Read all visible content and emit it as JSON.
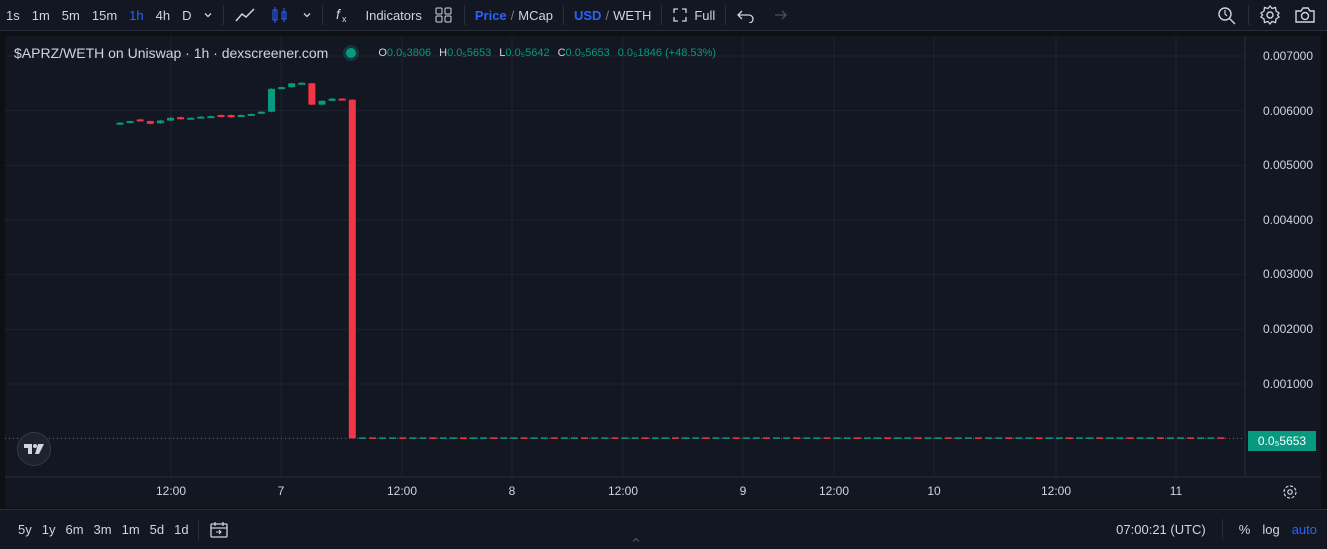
{
  "toolbar": {
    "intervals": [
      "1s",
      "1m",
      "5m",
      "15m",
      "1h",
      "4h",
      "D"
    ],
    "active_interval": "1h",
    "indicators_label": "Indicators",
    "price_label": "Price",
    "mcap_label": "MCap",
    "usd_label": "USD",
    "weth_label": "WETH",
    "full_label": "Full",
    "slash": "/"
  },
  "legend": {
    "symbol": "$APRZ/WETH on Uniswap · 1h · dexscreener.com",
    "o_key": "O",
    "o_val": "0.0₅3806",
    "h_key": "H",
    "h_val": "0.0₅5653",
    "l_key": "L",
    "l_val": "0.0₅5642",
    "c_key": "C",
    "c_val": "0.0₅5653",
    "change": "0.0₅1846 (+48.53%)"
  },
  "price_axis": [
    "0.007000",
    "0.006000",
    "0.005000",
    "0.004000",
    "0.003000",
    "0.002000",
    "0.001000"
  ],
  "last_price": "0.0₅5653",
  "time_axis": [
    "12:00",
    "7",
    "12:00",
    "8",
    "12:00",
    "9",
    "12:00",
    "10",
    "12:00",
    "11"
  ],
  "bottom": {
    "ranges": [
      "5y",
      "1y",
      "6m",
      "3m",
      "1m",
      "5d",
      "1d"
    ],
    "clock": "07:00:21 (UTC)",
    "percent": "%",
    "log": "log",
    "auto": "auto"
  },
  "colors": {
    "up": "#089981",
    "down": "#f23645",
    "accent": "#2962ff"
  },
  "chart_data": {
    "type": "candlestick",
    "title": "$APRZ/WETH on Uniswap · 1h · dexscreener.com",
    "ylim": [
      0,
      0.0072
    ],
    "y_ticks": [
      0.001,
      0.002,
      0.003,
      0.004,
      0.005,
      0.006,
      0.007
    ],
    "x_ticks": [
      "12:00",
      "7",
      "12:00",
      "8",
      "12:00",
      "9",
      "12:00",
      "10",
      "12:00",
      "11"
    ],
    "candles": [
      {
        "o": 0.00575,
        "c": 0.00578,
        "h": 0.00579,
        "l": 0.00574
      },
      {
        "o": 0.00578,
        "c": 0.00581,
        "h": 0.00582,
        "l": 0.00577
      },
      {
        "o": 0.00584,
        "c": 0.00581,
        "h": 0.00585,
        "l": 0.0058
      },
      {
        "o": 0.00581,
        "c": 0.00576,
        "h": 0.00582,
        "l": 0.00575
      },
      {
        "o": 0.00577,
        "c": 0.00582,
        "h": 0.00583,
        "l": 0.00576
      },
      {
        "o": 0.00582,
        "c": 0.00587,
        "h": 0.00588,
        "l": 0.00581
      },
      {
        "o": 0.00588,
        "c": 0.00585,
        "h": 0.00589,
        "l": 0.00584
      },
      {
        "o": 0.00585,
        "c": 0.00587,
        "h": 0.00588,
        "l": 0.00584
      },
      {
        "o": 0.00587,
        "c": 0.00589,
        "h": 0.0059,
        "l": 0.00586
      },
      {
        "o": 0.00589,
        "c": 0.0059,
        "h": 0.00591,
        "l": 0.00588
      },
      {
        "o": 0.00592,
        "c": 0.00589,
        "h": 0.00593,
        "l": 0.00588
      },
      {
        "o": 0.00592,
        "c": 0.00588,
        "h": 0.00593,
        "l": 0.00587
      },
      {
        "o": 0.0059,
        "c": 0.00592,
        "h": 0.00593,
        "l": 0.00589
      },
      {
        "o": 0.00592,
        "c": 0.00594,
        "h": 0.00595,
        "l": 0.00591
      },
      {
        "o": 0.00595,
        "c": 0.00598,
        "h": 0.00599,
        "l": 0.00594
      },
      {
        "o": 0.00598,
        "c": 0.0064,
        "h": 0.00641,
        "l": 0.00597
      },
      {
        "o": 0.0064,
        "c": 0.00643,
        "h": 0.00644,
        "l": 0.00639
      },
      {
        "o": 0.00643,
        "c": 0.0065,
        "h": 0.00651,
        "l": 0.00642
      },
      {
        "o": 0.0065,
        "c": 0.00651,
        "h": 0.00652,
        "l": 0.00649
      },
      {
        "o": 0.0065,
        "c": 0.00611,
        "h": 0.00651,
        "l": 0.0061
      },
      {
        "o": 0.00611,
        "c": 0.00618,
        "h": 0.00619,
        "l": 0.0061
      },
      {
        "o": 0.00618,
        "c": 0.00622,
        "h": 0.00623,
        "l": 0.00617
      },
      {
        "o": 0.00622,
        "c": 0.0062,
        "h": 0.00623,
        "l": 0.00619
      },
      {
        "o": 0.0062,
        "c": 5.6e-06,
        "h": 0.00621,
        "l": 5.6e-06
      }
    ],
    "flat_after": {
      "value": 5.6531e-06,
      "count": 86
    }
  }
}
